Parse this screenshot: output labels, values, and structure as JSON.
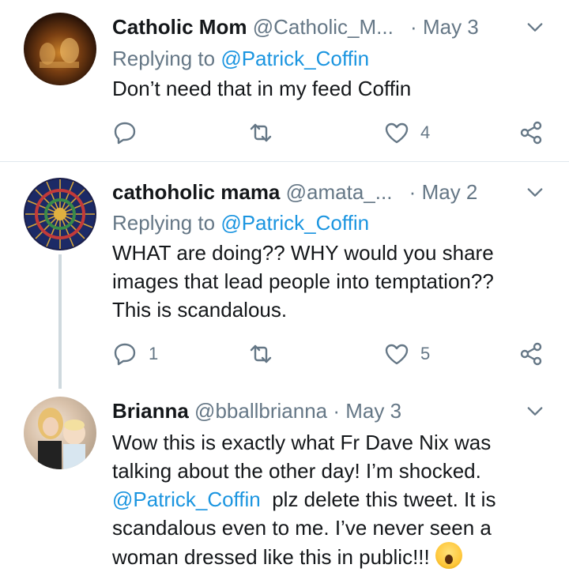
{
  "tweets": [
    {
      "name": "Catholic Mom",
      "handle": "@Catholic_M...",
      "date": "May 3",
      "replying_prefix": "Replying to",
      "replying_to": "@Patrick_Coffin",
      "text": "Don’t need that in my feed Coffin",
      "replies": "",
      "likes": "4"
    },
    {
      "name": "cathoholic mama",
      "handle": "@amata_...",
      "date": "May 2",
      "replying_prefix": "Replying to",
      "replying_to": "@Patrick_Coffin",
      "text_lines": [
        "WHAT are doing??  WHY would you share",
        "images that lead people into temptation??",
        "This is scandalous."
      ],
      "replies": "1",
      "likes": "5"
    },
    {
      "name": "Brianna",
      "handle": "@bballbrianna",
      "date": "May 3",
      "text_lines": [
        "Wow this is exactly what Fr Dave Nix was",
        "talking about the other day! I’m shocked."
      ],
      "mention": "@Patrick_Coffin",
      "text_after_mention": "  plz delete this tweet. It is",
      "text_lines_2": [
        "scandalous even to me.  I’ve never seen a",
        "woman dressed like this in public!!!"
      ],
      "emoji": "face-screaming-in-fear-icon"
    }
  ],
  "separator": "·",
  "colors": {
    "link": "#1b95e0",
    "muted": "#657786",
    "text": "#14171a"
  }
}
